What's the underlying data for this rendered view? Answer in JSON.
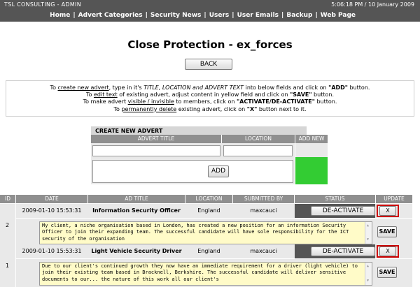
{
  "topbar": {
    "brand": "TSL CONSULTING - ADMIN",
    "clock": "5:06:18 PM / 10 January 2009",
    "nav": [
      "Home",
      "Advert Categories",
      "Security News",
      "Users",
      "User Emails",
      "Backup",
      "Web Page"
    ]
  },
  "page_title": "Close Protection - ex_forces",
  "back_label": "BACK",
  "instructions": {
    "l1_pre": "To ",
    "l1_link": "create new advert",
    "l1_mid": ", type in it's ",
    "l1_em": "TITLE, LOCATION and ADVERT TEXT",
    "l1_post": " into below fields and click on ",
    "l1_key": "\"ADD\"",
    "l1_end": " button.",
    "l2_pre": "To ",
    "l2_link": "edit text",
    "l2_mid": " of existing advert, adjust content in yellow field and click on ",
    "l2_key": "\"SAVE\"",
    "l2_end": " button.",
    "l3_pre": "To make advert ",
    "l3_link": "visible / invisible",
    "l3_mid": " to members, click on ",
    "l3_key": "\"ACTIVATE/DE-ACTIVATE\"",
    "l3_end": " button.",
    "l4_pre": "To ",
    "l4_link": "permanently delete",
    "l4_mid": " existing advert, click on ",
    "l4_key": "\"X\"",
    "l4_end": " button next to it."
  },
  "create": {
    "header": "CREATE NEW ADVERT",
    "col_title": "ADVERT TITLE",
    "col_location": "LOCATION",
    "col_add_new": "ADD NEW",
    "add_label": "ADD",
    "title_value": "",
    "location_value": "",
    "text_value": ""
  },
  "table": {
    "headers": [
      "ID",
      "DATE",
      "AD TITLE",
      "LOCATION",
      "SUBMITTED BY",
      "STATUS",
      "UPDATE"
    ],
    "rows": [
      {
        "id": "2",
        "date": "2009-01-10 15:53:31",
        "title": "Information Security Officer",
        "location": "England",
        "submitted_by": "maxcauci",
        "status_button": "DE-ACTIVATE",
        "delete_label": "X",
        "save_label": "SAVE",
        "text": "My client, a niche organisation based in London, has created a new position for an information Security Officer to join their expanding team. The successful candidate will have sole responsibility for the ICT security of the organisation"
      },
      {
        "id": "1",
        "date": "2009-01-10 15:53:31",
        "title": "Light Vehicle Security Driver",
        "location": "England",
        "submitted_by": "maxcauci",
        "status_button": "DE-ACTIVATE",
        "delete_label": "X",
        "save_label": "SAVE",
        "text": "Due to our client's continued growth they now have an immediate requirement for a driver (light vehicle) to join their existing team based in Bracknell, Berkshire. The successful candidate will deliver sensitive documents to our... the nature of this work all our client's"
      }
    ]
  },
  "colors": {
    "topbar": "#555555",
    "table_header": "#8f8f8f",
    "row_bg": "#e9e9e9",
    "add_cell": "#33cc33",
    "yellow_field": "#fffbc8",
    "delete_border": "#cc0000"
  }
}
